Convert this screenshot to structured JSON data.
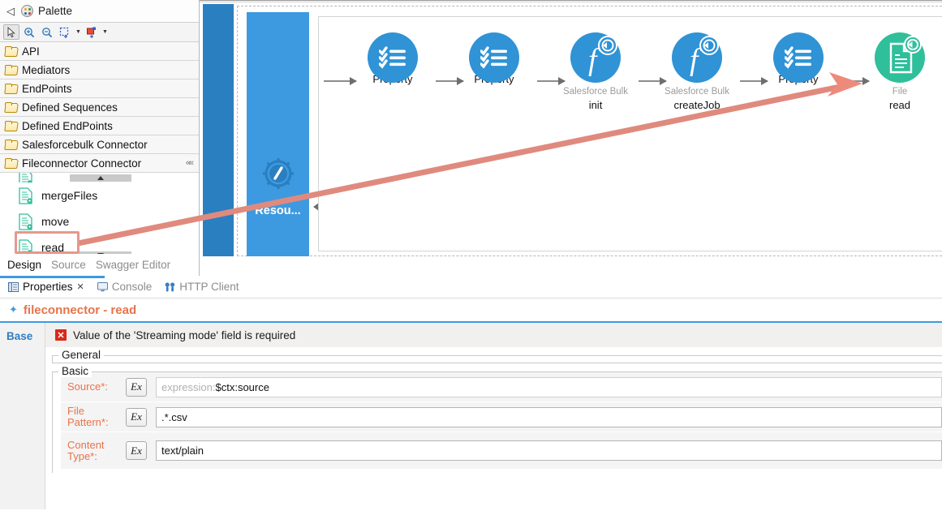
{
  "palette": {
    "title": "Palette",
    "logo_icon": "palette-icon",
    "collapse_left_icon": "chevron-left-icon",
    "toolbar": [
      {
        "name": "select-tool",
        "icon": "cursor-arrow-icon",
        "selected": true
      },
      {
        "name": "zoom-in-tool",
        "icon": "zoom-in-icon",
        "selected": false
      },
      {
        "name": "zoom-out-tool",
        "icon": "zoom-out-icon",
        "selected": false
      },
      {
        "name": "marquee-tool",
        "icon": "marquee-select-icon",
        "selected": false,
        "caret": true
      },
      {
        "name": "add-node-tool",
        "icon": "add-node-icon",
        "selected": false,
        "caret": true
      }
    ],
    "groups": [
      {
        "label": "API"
      },
      {
        "label": "Mediators"
      },
      {
        "label": "EndPoints"
      },
      {
        "label": "Defined Sequences"
      },
      {
        "label": "Defined EndPoints"
      },
      {
        "label": "Salesforcebulk Connector"
      },
      {
        "label": "Fileconnector Connector",
        "collapse_icon": "double-chevron-left-icon"
      }
    ],
    "items": [
      {
        "label": "mergeFiles"
      },
      {
        "label": "move"
      },
      {
        "label": "read",
        "highlighted": true
      }
    ],
    "scroll_up_icon": "scroll-up-arrow",
    "scroll_down_icon": "scroll-down-arrow"
  },
  "editor_tabs": [
    {
      "label": "Design",
      "active": true
    },
    {
      "label": "Source",
      "active": false
    },
    {
      "label": "Swagger Editor",
      "active": false
    }
  ],
  "canvas": {
    "resource_label": "Resou...",
    "resource_icon": "gear-slash-icon",
    "nodes": [
      {
        "sub": "",
        "name": "Property",
        "type": "property",
        "color": "#2f93d6",
        "selected": false
      },
      {
        "sub": "",
        "name": "Property",
        "type": "property",
        "color": "#2f93d6",
        "selected": false
      },
      {
        "sub": "Salesforce Bulk",
        "name": "init",
        "type": "connector",
        "color": "#2f93d6",
        "selected": false
      },
      {
        "sub": "Salesforce Bulk",
        "name": "createJob",
        "type": "connector",
        "color": "#2f93d6",
        "selected": false
      },
      {
        "sub": "",
        "name": "Property",
        "type": "property",
        "color": "#2f93d6",
        "selected": false
      },
      {
        "sub": "File",
        "name": "read",
        "type": "file",
        "color": "#2fbf9b",
        "selected": true
      }
    ],
    "drag_arrow_color": "#e08a7e"
  },
  "properties": {
    "tabs": [
      {
        "label": "Properties",
        "icon": "properties-icon",
        "active": true,
        "closeable": true
      },
      {
        "label": "Console",
        "icon": "console-icon",
        "active": false,
        "closeable": false
      },
      {
        "label": "HTTP Client",
        "icon": "http-client-icon",
        "active": false,
        "closeable": false
      }
    ],
    "close_glyph": "✕",
    "title": "fileconnector -  read",
    "title_icon": "diamond-icon",
    "side_items": [
      {
        "label": "Base",
        "active": true
      }
    ],
    "error": {
      "icon": "error-icon",
      "glyph": "✕",
      "message": "Value of the 'Streaming mode' field is required"
    },
    "sections": [
      {
        "legend": "General"
      },
      {
        "legend": "Basic"
      }
    ],
    "fields": [
      {
        "label": "Source*:",
        "ex_button": "Ex",
        "value": "",
        "placeholder_prefix": "expression: ",
        "placeholder_value": "$ctx:source",
        "is_placeholder": true,
        "row_shaded": true
      },
      {
        "label": "File Pattern*:",
        "ex_button": "Ex",
        "value": ".*.csv",
        "placeholder_prefix": "",
        "placeholder_value": "",
        "is_placeholder": false,
        "row_shaded": true
      },
      {
        "label": "Content Type*:",
        "ex_button": "Ex",
        "value": "text/plain",
        "placeholder_prefix": "",
        "placeholder_value": "",
        "is_placeholder": false,
        "row_shaded": true
      }
    ]
  },
  "colors": {
    "accent_blue": "#3d9ae0",
    "dark_blue": "#2a7fc0",
    "node_blue": "#2f93d6",
    "node_green": "#2fbf9b",
    "required_orange": "#e8734a",
    "error_red": "#d9291c",
    "drag_salmon": "#e08a7e"
  }
}
